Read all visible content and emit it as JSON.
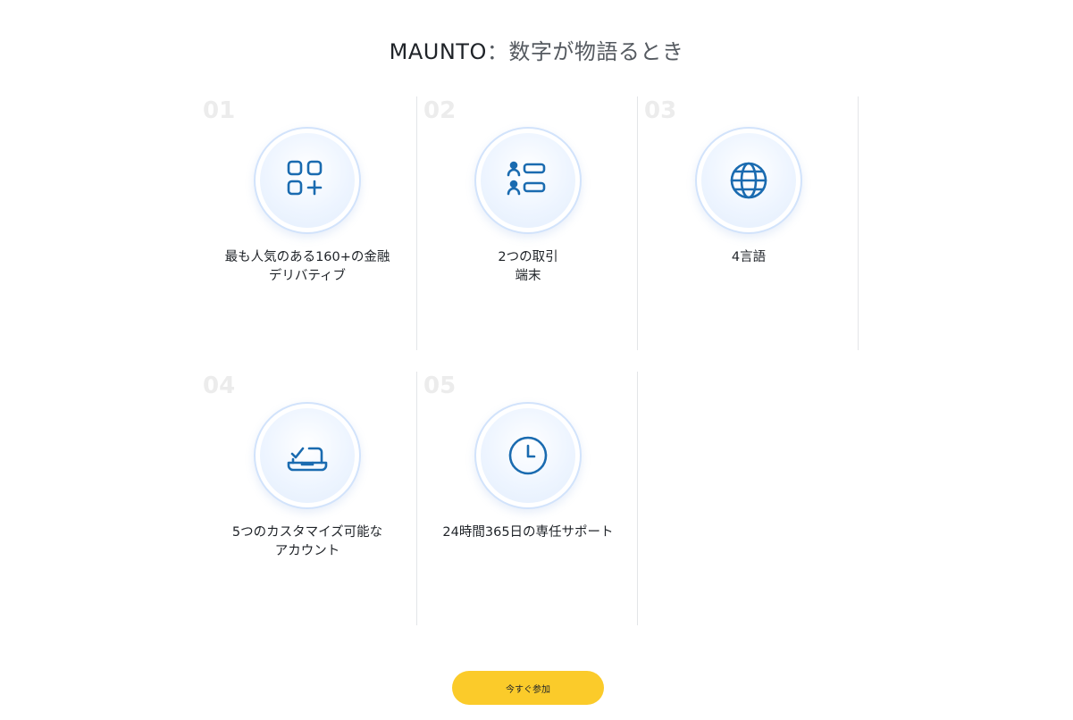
{
  "header": {
    "brand": "MAUNTO",
    "title_rest": "：数字が物語るとき"
  },
  "features": [
    {
      "number": "01",
      "icon": "apps-plus-icon",
      "line1": "最も人気のある160+の金融",
      "line2": "デリバティブ"
    },
    {
      "number": "02",
      "icon": "users-list-icon",
      "line1": "2つの取引",
      "line2": "端末"
    },
    {
      "number": "03",
      "icon": "globe-icon",
      "line1": "4言語",
      "line2": ""
    },
    {
      "number": "04",
      "icon": "laptop-check-icon",
      "line1": "5つのカスタマイズ可能な",
      "line2": "アカウント"
    },
    {
      "number": "05",
      "icon": "clock-icon",
      "line1": "24時間365日の専任サポート",
      "line2": ""
    }
  ],
  "cta": {
    "label": "今すぐ参加"
  },
  "colors": {
    "icon": "#1a6bb0",
    "accent": "#fbcb2a",
    "number": "#ececec"
  }
}
